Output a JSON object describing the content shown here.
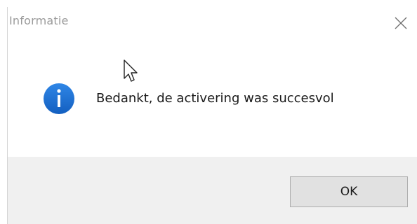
{
  "dialog": {
    "title": "Informatie",
    "message": "Bedankt, de activering was succesvol",
    "ok_label": "OK",
    "icon": "info-icon",
    "close_icon": "close-icon"
  },
  "colors": {
    "title_text": "#9a9a9a",
    "info_icon": "#1a6fd4",
    "footer_bg": "#f0f0f0",
    "button_bg": "#e1e1e1",
    "button_border": "#adadad"
  }
}
